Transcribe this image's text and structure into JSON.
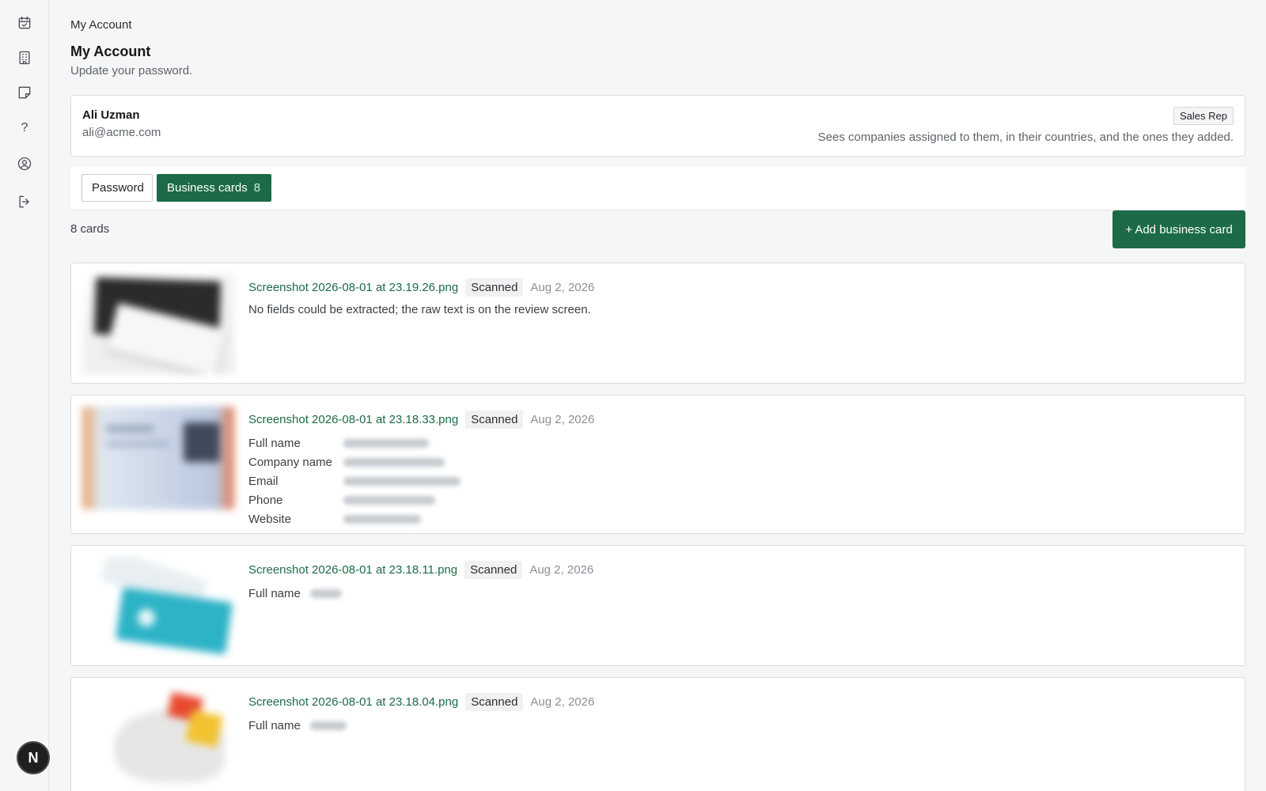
{
  "nav": {
    "icons": [
      "calendar-check-icon",
      "building-icon",
      "sticky-note-icon",
      "help-icon",
      "user-circle-icon",
      "logout-icon"
    ],
    "help_glyph": "?",
    "logo_letter": "N"
  },
  "breadcrumb": "My Account",
  "page": {
    "title": "My Account",
    "subtitle": "Update your password."
  },
  "user": {
    "name": "Ali Uzman",
    "email": "ali@acme.com",
    "role": "Sales Rep",
    "role_description": "Sees companies assigned to them, in their countries, and the ones they added."
  },
  "tabs": [
    {
      "label": "Password",
      "active": false
    },
    {
      "label": "Business cards",
      "count": "8",
      "active": true
    }
  ],
  "cards_summary": "8 cards",
  "add_button_label": "+ Add business card",
  "cards": [
    {
      "filename": "Screenshot 2026-08-01 at 23.19.26.png",
      "status": "Scanned",
      "date": "Aug 2, 2026",
      "message": "No fields could be extracted; the raw text is on the review screen."
    },
    {
      "filename": "Screenshot 2026-08-01 at 23.18.33.png",
      "status": "Scanned",
      "date": "Aug 2, 2026",
      "fields": [
        "Full name",
        "Company name",
        "Email",
        "Phone",
        "Website"
      ]
    },
    {
      "filename": "Screenshot 2026-08-01 at 23.18.11.png",
      "status": "Scanned",
      "date": "Aug 2, 2026",
      "fields": [
        "Full name"
      ]
    },
    {
      "filename": "Screenshot 2026-08-01 at 23.18.04.png",
      "status": "Scanned",
      "date": "Aug 2, 2026",
      "fields": [
        "Full name"
      ]
    }
  ],
  "colors": {
    "accent": "#1c6b46",
    "page_bg": "#f5f6f7",
    "border": "#d9dcdf"
  }
}
